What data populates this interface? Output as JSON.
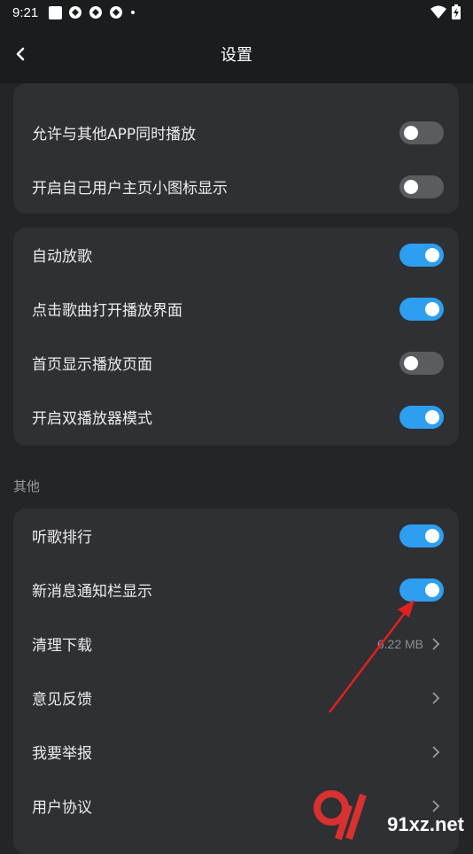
{
  "status_bar": {
    "time": "9:21"
  },
  "header": {
    "title": "设置",
    "back_icon": "chevron-left-icon"
  },
  "card1": {
    "rows": [
      {
        "label": "允许与其他APP同时播放",
        "toggle_on": false
      },
      {
        "label": "开启自己用户主页小图标显示",
        "toggle_on": false
      }
    ]
  },
  "card2": {
    "rows": [
      {
        "label": "自动放歌",
        "toggle_on": true
      },
      {
        "label": "点击歌曲打开播放界面",
        "toggle_on": true
      },
      {
        "label": "首页显示播放页面",
        "toggle_on": false
      },
      {
        "label": "开启双播放器模式",
        "toggle_on": true
      }
    ]
  },
  "section_other": {
    "title": "其他",
    "rows": [
      {
        "label": "听歌排行",
        "toggle_on": true
      },
      {
        "label": "新消息通知栏显示",
        "toggle_on": true
      },
      {
        "label": "清理下载",
        "value": "6.22 MB"
      },
      {
        "label": "意见反馈"
      },
      {
        "label": "我要举报"
      },
      {
        "label": "用户协议"
      }
    ]
  },
  "watermark": {
    "text": "91xz.net"
  },
  "colors": {
    "toggle_on": "#2d9ef0",
    "toggle_off": "#5a5c60",
    "card": "#2f3034",
    "background": "#242528",
    "annotation_arrow": "#e02020"
  }
}
